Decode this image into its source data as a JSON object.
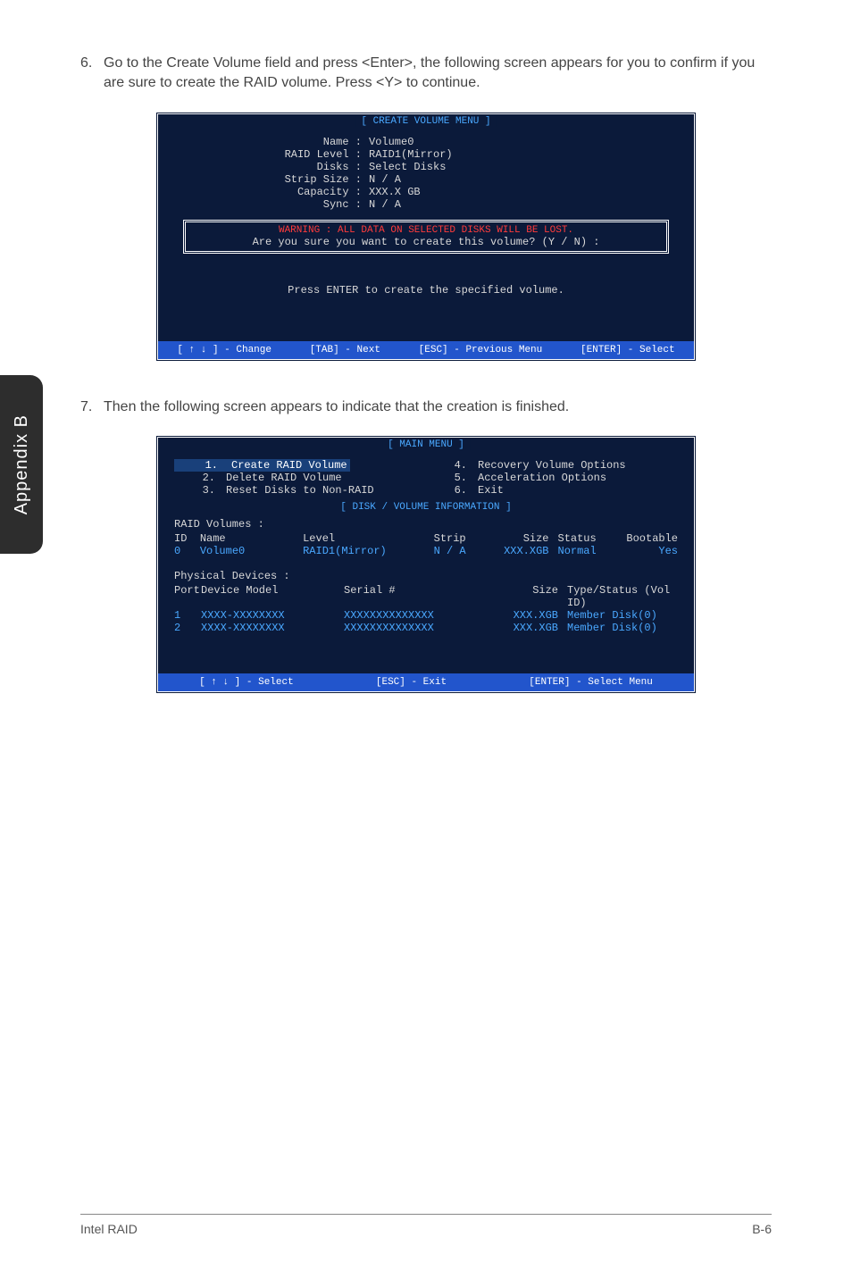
{
  "sidebar": {
    "label": "Appendix B"
  },
  "para1": {
    "num": "6.",
    "text": "Go to the Create Volume field and press <Enter>, the following screen appears for you to confirm if you are sure to create the RAID volume. Press <Y> to continue."
  },
  "screen1": {
    "title": "[  CREATE VOLUME MENU  ]",
    "fields": {
      "name_k": "Name :",
      "name_v": "Volume0",
      "raid_k": "RAID Level :",
      "raid_v": "RAID1(Mirror)",
      "disks_k": "Disks :",
      "disks_v": "Select Disks",
      "strip_k": "Strip Size :",
      "strip_v": "N / A",
      "cap_k": "Capacity :",
      "cap_v": "XXX.X  GB",
      "sync_k": "Sync :",
      "sync_v": "N / A"
    },
    "warning_line1": "WARNING :  ALL DATA ON SELECTED DISKS WILL BE LOST.",
    "warning_line2": "Are  you  sure  you  want  to  create  this  volume?   (Y / N)   :",
    "prompt": "Press  ENTER  to  create  the  specified  volume.",
    "footer": {
      "a": "[ ↑ ↓ ] - Change",
      "b": "[TAB] - Next",
      "c": "[ESC] - Previous Menu",
      "d": "[ENTER] - Select"
    }
  },
  "para2": {
    "num": "7.",
    "text": "Then the following screen appears to indicate that the creation is finished."
  },
  "screen2": {
    "title": "[   MAIN  MENU   ]",
    "menu": {
      "i1n": "1.",
      "i1t": "Create  RAID  Volume",
      "i2n": "2.",
      "i2t": "Delete  RAID  Volume",
      "i3n": "3.",
      "i3t": "Reset Disks to Non-RAID",
      "i4n": "4.",
      "i4t": "Recovery Volume  Options",
      "i5n": "5.",
      "i5t": "Acceleration Options",
      "i6n": "6.",
      "i6t": "Exit"
    },
    "div_title": "[   DISK / VOLUME INFORMATION   ]",
    "raid_label": "RAID  Volumes :",
    "head": {
      "id": "ID",
      "name": "Name",
      "level": "Level",
      "strip": "Strip",
      "size": "Size",
      "status": "Status",
      "boot": "Bootable"
    },
    "row": {
      "id": "0",
      "name": "Volume0",
      "level": "RAID1(Mirror)",
      "strip": "N / A",
      "size": "XXX.XGB",
      "status": "Normal",
      "boot": "Yes"
    },
    "pd_label": "Physical  Devices :",
    "pd_head": {
      "port": "Port",
      "model": "Device  Model",
      "serial": "Serial  #",
      "size": "Size",
      "type": "Type/Status (Vol  ID)"
    },
    "pd1": {
      "port": "1",
      "model": "XXXX-XXXXXXXX",
      "serial": "XXXXXXXXXXXXXX",
      "size": "XXX.XGB",
      "type": "Member  Disk(0)"
    },
    "pd2": {
      "port": "2",
      "model": "XXXX-XXXXXXXX",
      "serial": "XXXXXXXXXXXXXX",
      "size": "XXX.XGB",
      "type": "Member  Disk(0)"
    },
    "footer": {
      "a": "[ ↑ ↓ ] - Select",
      "b": "[ESC] - Exit",
      "c": "[ENTER] - Select Menu"
    }
  },
  "footer": {
    "left": "Intel RAID",
    "right": "B-6"
  }
}
